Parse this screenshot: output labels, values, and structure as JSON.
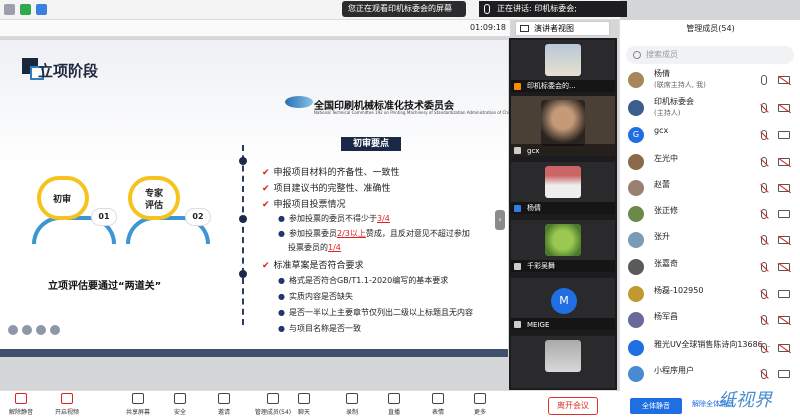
{
  "top": {
    "banner": "您正在观看印机标委会的屏幕",
    "speaker": "正在讲话: 印机标委会;",
    "timer": "01:09:18",
    "view_button": "演讲者视图"
  },
  "slide": {
    "stage_title": "立项阶段",
    "org_name": "全国印刷机械标准化技术委员会",
    "org_en": "National Technical Committee 192 on Printing Machinery of Standardization Administration of China",
    "panel_head": "初审要点",
    "circle1_label": "初审",
    "circle1_num": "01",
    "circle2_label_1": "专家",
    "circle2_label_2": "评估",
    "circle2_num": "02",
    "two_gates": "立项评估要通过“两道关”",
    "items": [
      {
        "t": "申报项目材料的齐备性、一致性"
      },
      {
        "t": "项目建议书的完整性、准确性"
      },
      {
        "t": "申报项目投票情况"
      },
      {
        "a": "参加投票的委员不得少于",
        "h": "3/4"
      },
      {
        "a": "参加投票委员",
        "h": "2/3以上",
        "b": "赞成，且反对意见不超过参加"
      },
      {
        "a": "投票委员的",
        "h": "1/4"
      },
      {
        "t": "标准草案是否符合要求"
      },
      {
        "t": "格式是否符合GB/T1.1-2020编写的基本要求"
      },
      {
        "t": "实质内容是否缺失"
      },
      {
        "t": "是否一半以上主要章节仅列出二级以上标题且无内容"
      },
      {
        "t": "与项目名称是否一致"
      }
    ]
  },
  "gallery": [
    {
      "name": "印机标委会的..."
    },
    {
      "name": "gcx"
    },
    {
      "name": "杨倩"
    },
    {
      "name": "千彩吴舞"
    },
    {
      "name": "MEIGE",
      "initial": "M"
    }
  ],
  "members": {
    "title": "管理成员(54)",
    "search_placeholder": "搜索成员",
    "list": [
      {
        "name": "杨倩",
        "sub": "(联席主持人, 我)",
        "color": "#a8855a"
      },
      {
        "name": "印机标委会",
        "sub": "(主持人)",
        "color": "#3b5e8c"
      },
      {
        "name": "gcx",
        "initial": "G",
        "color": "#1f6fe3"
      },
      {
        "name": "左光中",
        "color": "#8a6a4a"
      },
      {
        "name": "赵蕾",
        "color": "#9a8070"
      },
      {
        "name": "张正修",
        "color": "#6a8a4a"
      },
      {
        "name": "张升",
        "color": "#7a9ab8"
      },
      {
        "name": "张嘉奇",
        "color": "#5a5a5a"
      },
      {
        "name": "杨磊-102950",
        "color": "#c09a30"
      },
      {
        "name": "杨军昌",
        "color": "#6a6a9a"
      },
      {
        "name": "雅光UV全球销售陈诗向13686...",
        "color": "#1f6fe3"
      },
      {
        "name": "小程序用户",
        "color": "#4a8ad0"
      }
    ],
    "mute_all": "全体静音",
    "unmute_all": "解除全体静音"
  },
  "toolbar": {
    "items": [
      "解除静音",
      "开启视频",
      "共享屏幕",
      "安全",
      "邀请",
      "管理成员(54)",
      "聊天",
      "录制",
      "直播",
      "表情",
      "更多"
    ],
    "leave": "离开会议"
  },
  "watermark": "纸视界"
}
